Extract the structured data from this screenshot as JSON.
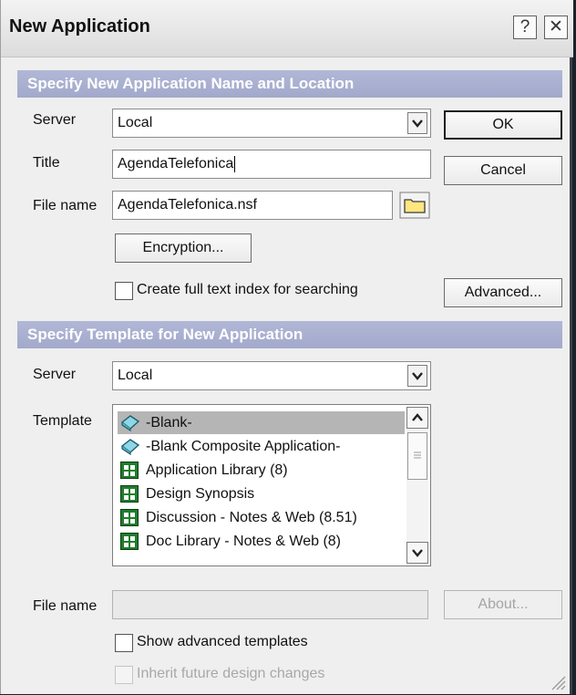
{
  "window": {
    "title": "New Application",
    "help_glyph": "?",
    "close_glyph": "✕"
  },
  "section1": {
    "heading": "Specify New Application Name and Location",
    "server_label": "Server",
    "server_value": "Local",
    "title_label": "Title",
    "title_value": "AgendaTelefonica",
    "filename_label": "File name",
    "filename_value": "AgendaTelefonica.nsf",
    "encryption_button": "Encryption...",
    "fulltext_checkbox_label": "Create full text index for searching",
    "fulltext_checked": false
  },
  "buttons": {
    "ok": "OK",
    "cancel": "Cancel",
    "advanced": "Advanced...",
    "about": "About..."
  },
  "section2": {
    "heading": "Specify Template for New Application",
    "server_label": "Server",
    "server_value": "Local",
    "template_label": "Template",
    "templates": [
      {
        "label": "-Blank-",
        "icon": "blank-template-icon",
        "selected": true
      },
      {
        "label": "-Blank Composite Application-",
        "icon": "blank-template-icon",
        "selected": false
      },
      {
        "label": "Application Library (8)",
        "icon": "notes-database-icon",
        "selected": false
      },
      {
        "label": "Design Synopsis",
        "icon": "notes-database-icon",
        "selected": false
      },
      {
        "label": "Discussion - Notes & Web (8.51)",
        "icon": "notes-database-icon",
        "selected": false
      },
      {
        "label": "Doc Library - Notes & Web (8)",
        "icon": "notes-database-icon",
        "selected": false
      }
    ],
    "filename_label": "File name",
    "filename_value": "",
    "show_advanced_label": "Show advanced templates",
    "show_advanced_checked": false,
    "inherit_label": "Inherit future design changes",
    "inherit_checked": false,
    "inherit_enabled": false
  },
  "colors": {
    "section_header": "#a9b0d0",
    "dialog_bg": "#efefef",
    "desktop_bg": "#1b2128",
    "selection": "#b5b5b5",
    "folder_icon": "#ffe680"
  }
}
